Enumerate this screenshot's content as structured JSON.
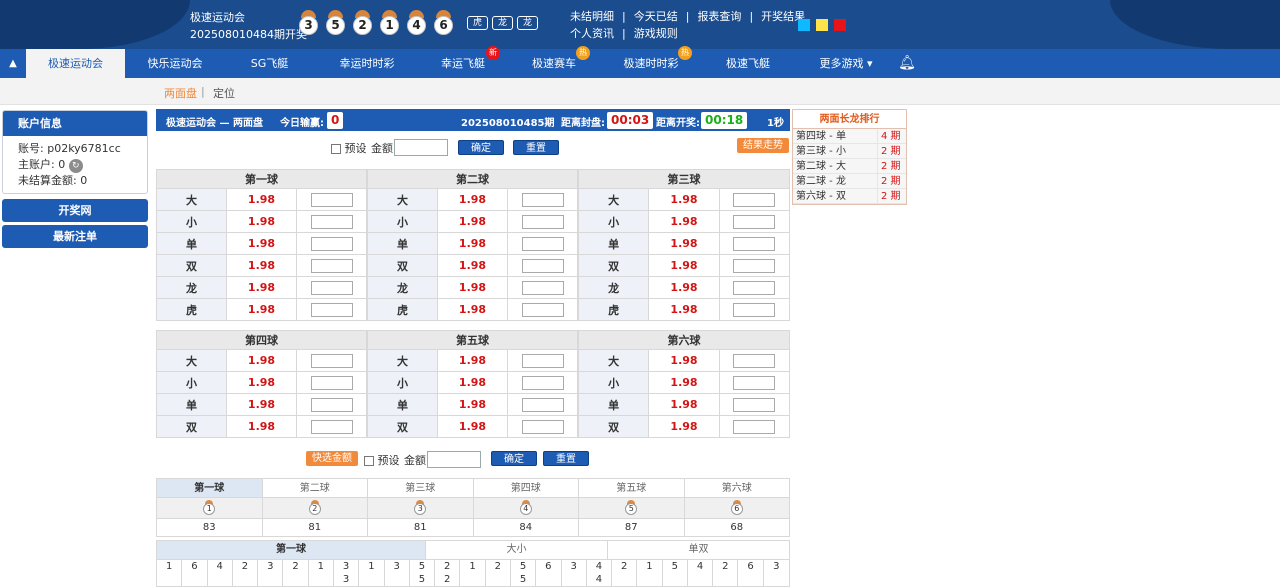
{
  "header": {
    "game": "极速运动会",
    "draw": "202508010484期开奖",
    "balls": [
      "3",
      "5",
      "2",
      "1",
      "4",
      "6"
    ],
    "dragon_tags": [
      "虎",
      "龙",
      "龙"
    ],
    "links_row1": [
      "未结明细",
      "今天已结",
      "报表查询",
      "开奖结果"
    ],
    "links_row2": [
      "个人资讯",
      "游戏规则"
    ],
    "swatches": [
      "#0fb9ff",
      "#ffe14a",
      "#e8141a"
    ]
  },
  "tabs": [
    {
      "label": "极速运动会"
    },
    {
      "label": "快乐运动会"
    },
    {
      "label": "SG飞艇"
    },
    {
      "label": "幸运时时彩"
    },
    {
      "label": "幸运飞艇",
      "badge": "新"
    },
    {
      "label": "极速赛车",
      "badge": "热"
    },
    {
      "label": "极速时时彩",
      "badge": "热"
    },
    {
      "label": "极速飞艇"
    },
    {
      "label": "更多游戏"
    }
  ],
  "subnav": {
    "active": "两面盘",
    "sep": "|",
    "other": "定位"
  },
  "account": {
    "title": "账户信息",
    "account_label": "账号:",
    "account": "p02ky6781cc",
    "main_label": "主账户:",
    "main": "0",
    "unsettled_label": "未结算金额:",
    "unsettled": "0"
  },
  "side_buttons": [
    "开奖网",
    "最新注单"
  ],
  "bar": {
    "game": "极速运动会 — 两面盘",
    "today_label": "今日输赢:",
    "today": "0",
    "period": "202508010485期",
    "close_label": "距离封盘:",
    "close": "00:03",
    "open_label": "距离开奖:",
    "open": "00:18",
    "seconds": "1秒"
  },
  "controls": {
    "preset": "预设",
    "amount": "金额",
    "confirm": "确定",
    "reset": "重置",
    "trend": "结果走势",
    "quick": "快选金额"
  },
  "group1": {
    "balls": [
      "第一球",
      "第二球",
      "第三球"
    ],
    "rows": [
      {
        "n": "大",
        "o": "1.98"
      },
      {
        "n": "小",
        "o": "1.98"
      },
      {
        "n": "单",
        "o": "1.98"
      },
      {
        "n": "双",
        "o": "1.98"
      },
      {
        "n": "龙",
        "o": "1.98"
      },
      {
        "n": "虎",
        "o": "1.98"
      }
    ]
  },
  "group2": {
    "balls": [
      "第四球",
      "第五球",
      "第六球"
    ],
    "rows": [
      {
        "n": "大",
        "o": "1.98"
      },
      {
        "n": "小",
        "o": "1.98"
      },
      {
        "n": "单",
        "o": "1.98"
      },
      {
        "n": "双",
        "o": "1.98"
      }
    ]
  },
  "rank": {
    "title": "两面长龙排行",
    "rows": [
      {
        "k": "第四球 - 单",
        "v": "4 期"
      },
      {
        "k": "第三球 - 小",
        "v": "2 期"
      },
      {
        "k": "第二球 - 大",
        "v": "2 期"
      },
      {
        "k": "第二球 - 龙",
        "v": "2 期"
      },
      {
        "k": "第六球 - 双",
        "v": "2 期"
      }
    ]
  },
  "stats": {
    "tabs": [
      "第一球",
      "第二球",
      "第三球",
      "第四球",
      "第五球",
      "第六球"
    ],
    "icons": [
      "1",
      "2",
      "3",
      "4",
      "5",
      "6"
    ],
    "counts": [
      "83",
      "81",
      "81",
      "84",
      "87",
      "68"
    ]
  },
  "trend": {
    "tabs": [
      "第一球",
      "大小",
      "单双"
    ],
    "cols": [
      [
        "1"
      ],
      [
        "6"
      ],
      [
        "4"
      ],
      [
        "2"
      ],
      [
        "3"
      ],
      [
        "2"
      ],
      [
        "1"
      ],
      [
        "3",
        "3"
      ],
      [
        "1"
      ],
      [
        "3"
      ],
      [
        "5",
        "5"
      ],
      [
        "2",
        "2"
      ],
      [
        "1"
      ],
      [
        "2"
      ],
      [
        "5",
        "5"
      ],
      [
        "6"
      ],
      [
        "3"
      ],
      [
        "4",
        "4"
      ],
      [
        "2"
      ],
      [
        "1"
      ],
      [
        "5"
      ],
      [
        "4"
      ],
      [
        "2"
      ],
      [
        "6"
      ],
      [
        "3"
      ]
    ]
  }
}
